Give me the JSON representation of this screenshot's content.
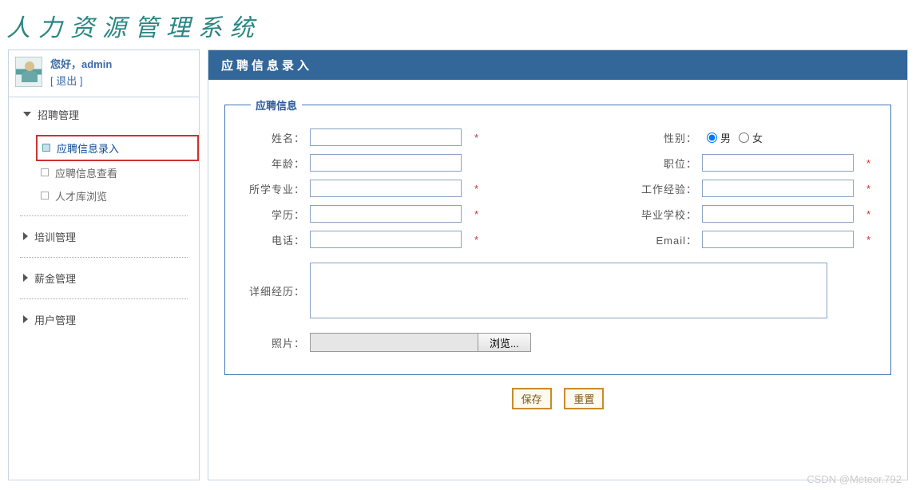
{
  "app_title": "人力资源管理系统",
  "user": {
    "greeting": "您好，",
    "name": "admin",
    "logout": "[ 退出 ]"
  },
  "sidebar": {
    "groups": [
      {
        "label": "招聘管理",
        "expanded": true,
        "items": [
          {
            "label": "应聘信息录入",
            "active": true
          },
          {
            "label": "应聘信息查看",
            "active": false
          },
          {
            "label": "人才库浏览",
            "active": false
          }
        ]
      },
      {
        "label": "培训管理",
        "expanded": false
      },
      {
        "label": "薪金管理",
        "expanded": false
      },
      {
        "label": "用户管理",
        "expanded": false
      }
    ]
  },
  "content": {
    "header": "应聘信息录入",
    "fieldset_title": "应聘信息",
    "fields": {
      "name": {
        "label": "姓名：",
        "value": "",
        "required": true
      },
      "gender": {
        "label": "性别：",
        "options": [
          "男",
          "女"
        ],
        "selected": "男"
      },
      "age": {
        "label": "年龄：",
        "value": "",
        "required": false
      },
      "position": {
        "label": "职位：",
        "value": "",
        "required": true
      },
      "major": {
        "label": "所学专业：",
        "value": "",
        "required": true
      },
      "experience": {
        "label": "工作经验：",
        "value": "",
        "required": true
      },
      "education": {
        "label": "学历：",
        "value": "",
        "required": true
      },
      "school": {
        "label": "毕业学校：",
        "value": "",
        "required": true
      },
      "phone": {
        "label": "电话：",
        "value": "",
        "required": true
      },
      "email": {
        "label": "Email：",
        "value": "",
        "required": true
      },
      "resume": {
        "label": "详细经历：",
        "value": ""
      },
      "photo": {
        "label": "照片：",
        "value": "",
        "browse": "浏览..."
      }
    },
    "actions": {
      "save": "保存",
      "reset": "重置"
    }
  },
  "watermark": "CSDN @Meteor.792"
}
